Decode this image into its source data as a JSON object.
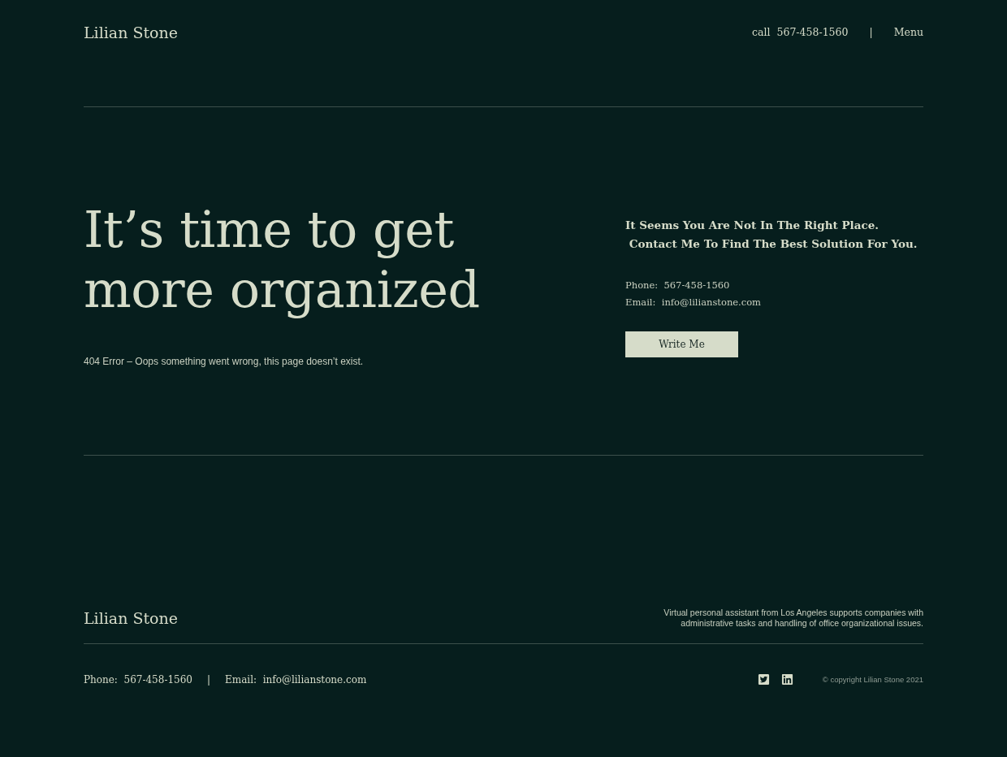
{
  "header": {
    "logo": "Lilian Stone",
    "call": "call  567-458-1560",
    "separator": "|",
    "menu": "Menu"
  },
  "hero": {
    "title_lines": [
      "It’s time to get",
      "more organized"
    ],
    "error_text": "404 Error – Oops something went wrong, this page doesn’t exist."
  },
  "contact": {
    "heading_lines": [
      "It Seems You Are Not In The Right Place.",
      " Contact Me To Find The Best Solution For You."
    ],
    "phone": "Phone:  567-458-1560",
    "email": "Email:  info@lilianstone.com",
    "button": "Write Me"
  },
  "footer": {
    "logo": "Lilian Stone",
    "description": "Virtual personal assistant from Los Angeles supports companies with administrative tasks and handling of office organizational issues.",
    "phone": "Phone:  567-458-1560",
    "separator": "|",
    "email": "Email:  info@lilianstone.com",
    "socials": [
      {
        "kind": "twitter"
      },
      {
        "kind": "linkedin"
      }
    ],
    "copyright": "© copyright Lilian Stone 2021"
  }
}
